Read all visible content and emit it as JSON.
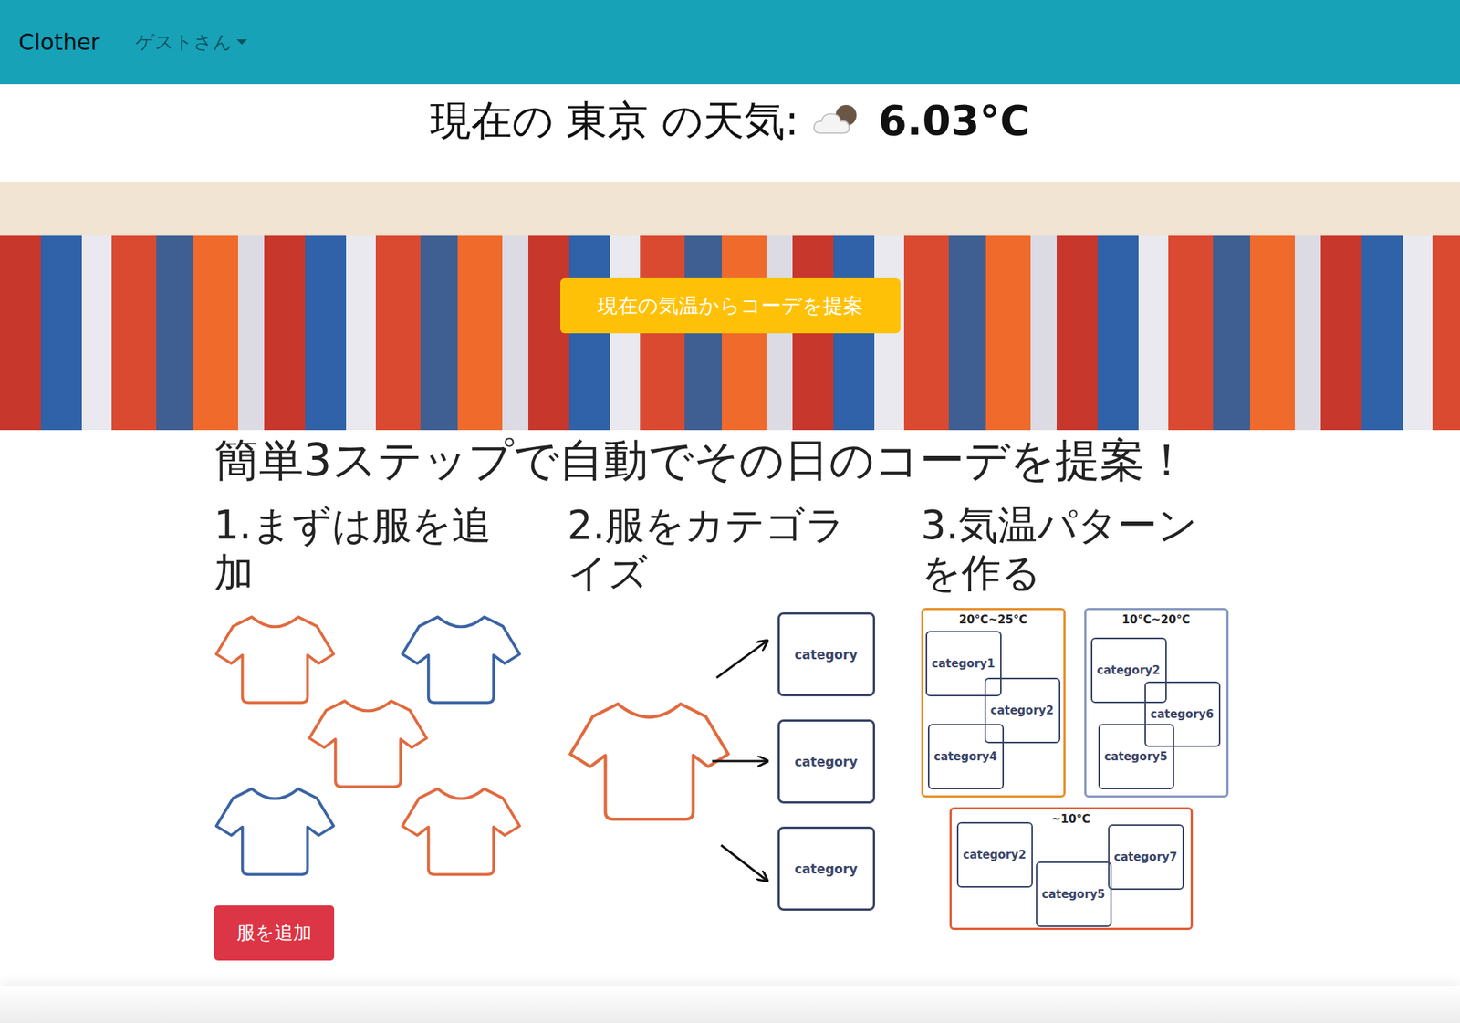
{
  "navbar": {
    "brand": "Clother",
    "user_menu": {
      "label": "ゲストさん",
      "expanded": false
    }
  },
  "weather": {
    "label": "現在の 東京 の天気:",
    "temperature": "6.03°C"
  },
  "hero": {
    "button": "現在の気温からコーデを提案"
  },
  "steps_title": "簡単3ステップで自動でその日のコーデを提案！",
  "steps": [
    {
      "kind": "clothes",
      "title": "1.まずは服を追加",
      "shirts": [
        {
          "color": "#e06a3e"
        },
        {
          "color": "#3a63a4"
        },
        {
          "color": "#e06a3e"
        },
        {
          "color": "#3a63a4"
        },
        {
          "color": "#e06a3e"
        }
      ],
      "button": "服を追加"
    },
    {
      "kind": "categorize",
      "title": "2.服をカテゴライズ",
      "categories": [
        "category",
        "category",
        "category"
      ]
    },
    {
      "kind": "patterns",
      "title": "3.気温パターンを作る",
      "patterns": [
        {
          "range": "20°C~25°C",
          "color": "#e8922e",
          "categories": [
            "category1",
            "category2",
            "category4"
          ]
        },
        {
          "range": "10°C~20°C",
          "color": "#8a9bc2",
          "categories": [
            "category2",
            "category6",
            "category5"
          ]
        },
        {
          "range": "~10°C",
          "color": "#e0603a",
          "categories": [
            "category2",
            "category5",
            "category7"
          ]
        }
      ]
    }
  ]
}
